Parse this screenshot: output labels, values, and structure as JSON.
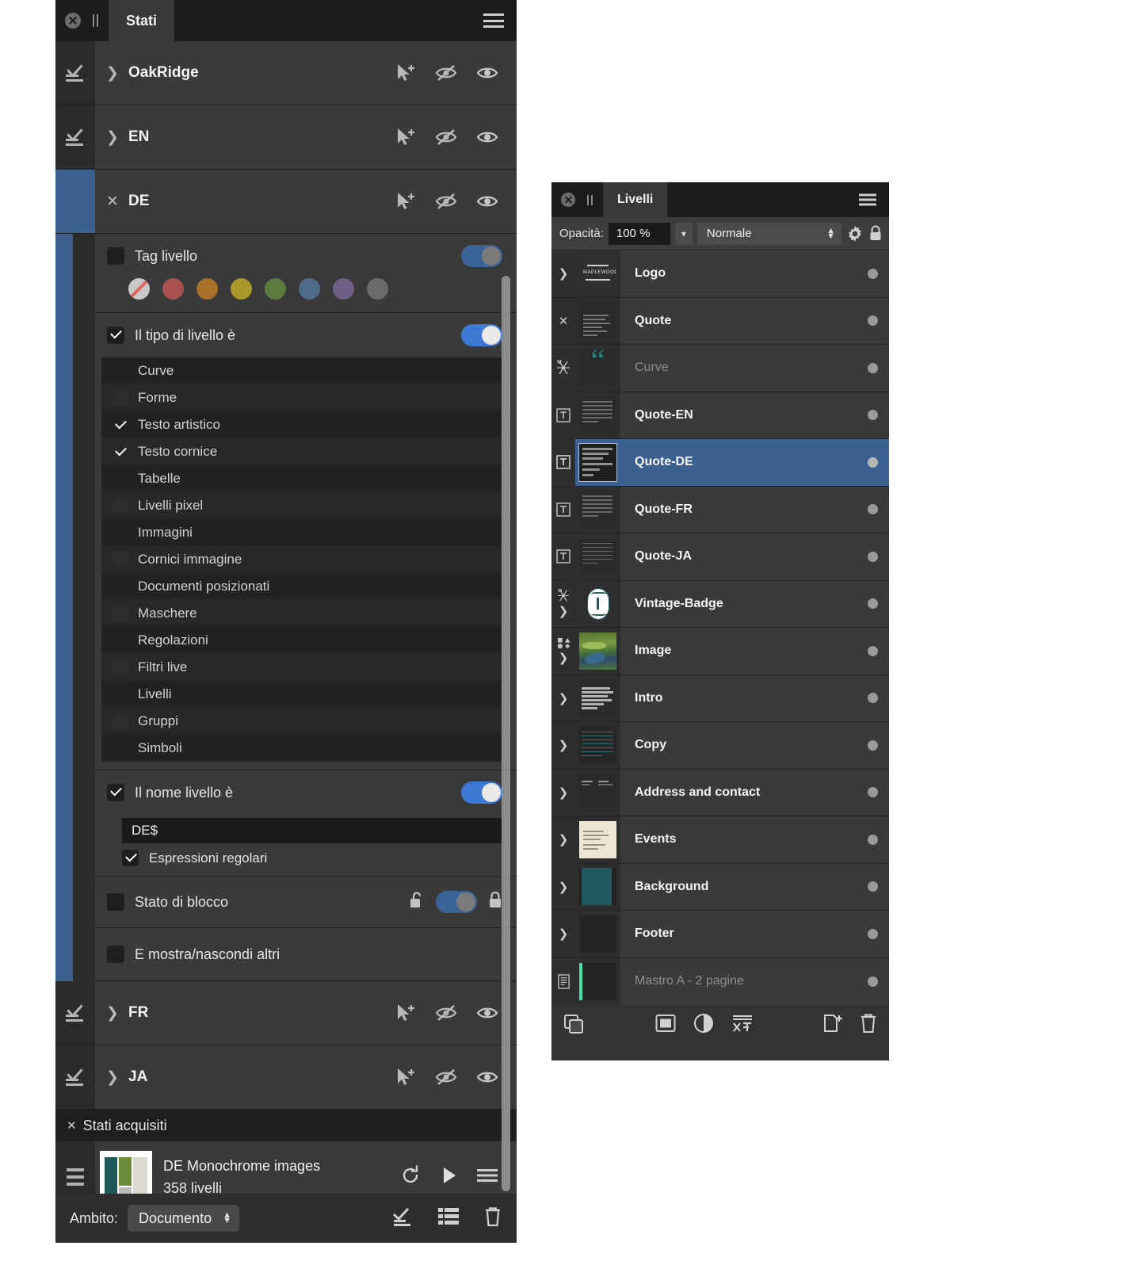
{
  "stati_panel": {
    "title": "Stati",
    "close_icon": "close-icon",
    "menu_icon": "hamburger-menu-icon",
    "states": [
      {
        "name": "OakRidge",
        "expanded": false,
        "selected": false
      },
      {
        "name": "EN",
        "expanded": false,
        "selected": false
      },
      {
        "name": "DE",
        "expanded": true,
        "selected": true
      },
      {
        "name": "FR",
        "expanded": false,
        "selected": false
      },
      {
        "name": "JA",
        "expanded": false,
        "selected": false
      }
    ],
    "row_icons": [
      "pointer-plus-icon",
      "eye-off-icon",
      "eye-icon"
    ],
    "filters": {
      "tag": {
        "label": "Tag livello",
        "checked": false,
        "toggle_on": true,
        "toggle_dim": true,
        "swatches": [
          {
            "name": "none",
            "color": "#c9c9c9"
          },
          {
            "name": "red",
            "color": "#a8504e"
          },
          {
            "name": "orange",
            "color": "#a8712a"
          },
          {
            "name": "yellow",
            "color": "#a8972a"
          },
          {
            "name": "green",
            "color": "#5a7a3e"
          },
          {
            "name": "blue",
            "color": "#4f6b8c"
          },
          {
            "name": "purple",
            "color": "#6e5f85"
          },
          {
            "name": "gray",
            "color": "#6b6b6b"
          }
        ]
      },
      "layer_type": {
        "label": "Il tipo di livello è",
        "checked": true,
        "toggle_on": true,
        "items": [
          {
            "label": "Curve",
            "checked": false,
            "box": false
          },
          {
            "label": "Forme",
            "checked": false,
            "box": true
          },
          {
            "label": "Testo artistico",
            "checked": true,
            "box": false
          },
          {
            "label": "Testo cornice",
            "checked": true,
            "box": false
          },
          {
            "label": "Tabelle",
            "checked": false,
            "box": false
          },
          {
            "label": "Livelli pixel",
            "checked": false,
            "box": true
          },
          {
            "label": "Immagini",
            "checked": false,
            "box": false
          },
          {
            "label": "Cornici immagine",
            "checked": false,
            "box": true
          },
          {
            "label": "Documenti posizionati",
            "checked": false,
            "box": false
          },
          {
            "label": "Maschere",
            "checked": false,
            "box": true
          },
          {
            "label": "Regolazioni",
            "checked": false,
            "box": false
          },
          {
            "label": "Filtri live",
            "checked": false,
            "box": true
          },
          {
            "label": "Livelli",
            "checked": false,
            "box": false
          },
          {
            "label": "Gruppi",
            "checked": false,
            "box": true
          },
          {
            "label": "Simboli",
            "checked": false,
            "box": false
          }
        ]
      },
      "layer_name": {
        "label": "Il nome livello è",
        "checked": true,
        "toggle_on": true,
        "value": "DE$",
        "regex_label": "Espressioni regolari",
        "regex_checked": true
      },
      "lock_state": {
        "label": "Stato di blocco",
        "checked": false,
        "toggle_on": true,
        "toggle_dim": true,
        "unlock_icon": "unlock-icon",
        "lock_icon": "lock-icon"
      },
      "show_hide_others": {
        "label": "E mostra/nascondi altri",
        "checked": false
      }
    },
    "acquired": {
      "header": "Stati acquisiti",
      "items": [
        {
          "title": "DE Monochrome images",
          "subtitle": "358 livelli",
          "icons": [
            "reload-icon",
            "play-icon",
            "hamburger-menu-icon"
          ]
        }
      ]
    },
    "footer": {
      "scope_label": "Ambito:",
      "scope_value": "Documento",
      "icons": [
        "add-state-icon",
        "list-icon",
        "trash-icon"
      ]
    }
  },
  "livelli_panel": {
    "title": "Livelli",
    "close_icon": "close-icon",
    "menu_icon": "hamburger-menu-icon",
    "opacity_label": "Opacità:",
    "opacity_value": "100 %",
    "blend_mode": "Normale",
    "gear_icon": "gear-icon",
    "lock_icon": "lock-icon",
    "layers": [
      {
        "name": "Logo",
        "indent": 0,
        "expander": ">",
        "selected": false,
        "dim": false,
        "thumb": "logo-maplewood",
        "type_icon": ""
      },
      {
        "name": "Quote",
        "indent": 0,
        "expander": "v",
        "selected": false,
        "dim": false,
        "thumb": "quote-doc",
        "type_icon": ""
      },
      {
        "name": "Curve",
        "indent": 1,
        "expander": "",
        "selected": false,
        "dim": true,
        "thumb": "quote-marks",
        "type_icon": "curve-node-icon"
      },
      {
        "name": "Quote-EN",
        "indent": 1,
        "expander": "",
        "selected": false,
        "dim": false,
        "thumb": "text-block",
        "type_icon": "text-frame-icon"
      },
      {
        "name": "Quote-DE",
        "indent": 1,
        "expander": "",
        "selected": true,
        "dim": false,
        "thumb": "text-block-sel",
        "type_icon": "text-frame-icon"
      },
      {
        "name": "Quote-FR",
        "indent": 1,
        "expander": "",
        "selected": false,
        "dim": false,
        "thumb": "text-block",
        "type_icon": "text-frame-icon"
      },
      {
        "name": "Quote-JA",
        "indent": 1,
        "expander": "",
        "selected": false,
        "dim": false,
        "thumb": "text-block",
        "type_icon": "text-frame-icon"
      },
      {
        "name": "Vintage-Badge",
        "indent": 0,
        "expander": ">",
        "selected": false,
        "dim": false,
        "thumb": "badge",
        "type_icon": "curve-node-icon"
      },
      {
        "name": "Image",
        "indent": 0,
        "expander": ">",
        "selected": false,
        "dim": false,
        "thumb": "photo",
        "type_icon": "shapes-icon"
      },
      {
        "name": "Intro",
        "indent": 0,
        "expander": ">",
        "selected": false,
        "dim": false,
        "thumb": "lines-light",
        "type_icon": ""
      },
      {
        "name": "Copy",
        "indent": 0,
        "expander": ">",
        "selected": false,
        "dim": false,
        "thumb": "lines-teal",
        "type_icon": ""
      },
      {
        "name": "Address and contact",
        "indent": 0,
        "expander": ">",
        "selected": false,
        "dim": false,
        "thumb": "lines-sparse",
        "type_icon": ""
      },
      {
        "name": "Events",
        "indent": 0,
        "expander": ">",
        "selected": false,
        "dim": false,
        "thumb": "paper-cream",
        "type_icon": ""
      },
      {
        "name": "Background",
        "indent": 0,
        "expander": ">",
        "selected": false,
        "dim": false,
        "thumb": "teal-fill",
        "type_icon": ""
      },
      {
        "name": "Footer",
        "indent": 0,
        "expander": ">",
        "selected": false,
        "dim": false,
        "thumb": "dark-fill",
        "type_icon": ""
      },
      {
        "name": "Mastro A - 2 pagine",
        "indent": 0,
        "expander": "",
        "selected": false,
        "dim": true,
        "thumb": "master-page",
        "type_icon": "master-icon"
      }
    ],
    "footer_icons": [
      "duplicate-layer-icon",
      "mask-icon",
      "adjustment-icon",
      "fx-icon",
      "add-layer-icon",
      "trash-icon"
    ]
  }
}
